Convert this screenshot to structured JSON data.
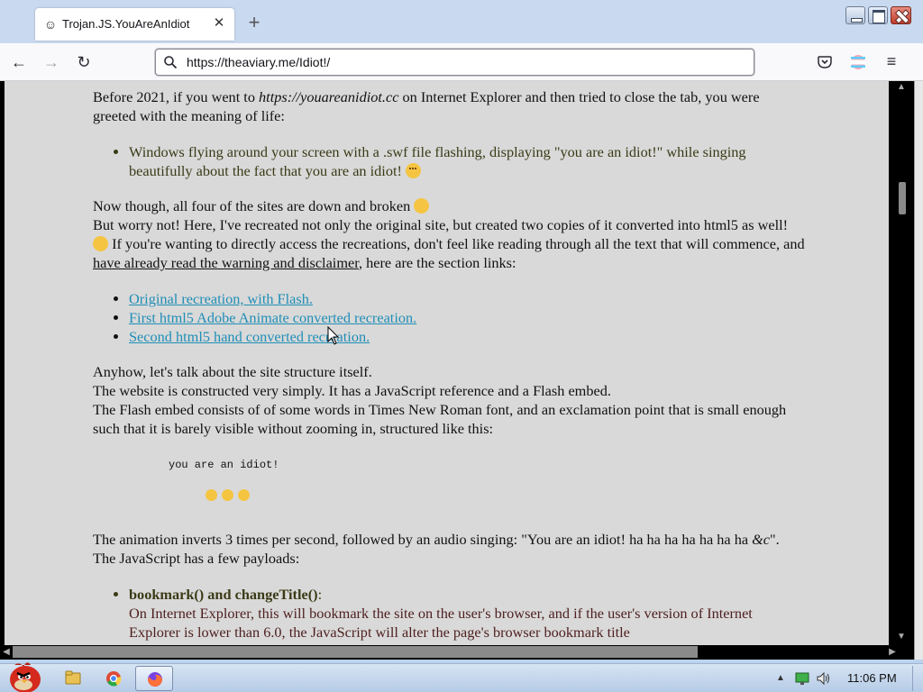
{
  "browser": {
    "tab": {
      "title": "Trojan.JS.YouAreAnIdiot",
      "favicon": "smiley-icon"
    },
    "url": "https://theaviary.me/Idiot!/",
    "toolbar_icons": [
      "back-icon",
      "forward-icon",
      "reload-icon",
      "search-icon",
      "pocket-icon",
      "account-icon",
      "menu-icon"
    ]
  },
  "article": {
    "p1_before": "Before 2021, if you went to ",
    "p1_site": "https://youareanidiot.cc",
    "p1_after": " on Internet Explorer and then tried to close the tab, you were greeted with the meaning of life:",
    "bullet1": "Windows flying around your screen with a .swf file flashing, displaying \"you are an idiot!\" while singing beautifully about the fact that you are an idiot!",
    "p2_line1": "Now though, all four of the sites are down and broken",
    "p2_line2": "But worry not! Here, I've recreated not only the original site, but created two copies of it converted into html5 as well!",
    "p2_line3_before": " If you're wanting to directly access the recreations, don't feel like reading through all the text that will commence, and ",
    "p2_line3_link": "have already read the warning and disclaimer",
    "p2_line3_after": ", here are the section links:",
    "links": [
      "Original recreation, with Flash.",
      "First html5 Adobe Animate converted recreation.",
      "Second html5 hand converted recreation."
    ],
    "p3_line1": "Anyhow, let's talk about the site structure itself.",
    "p3_line2": "The website is constructed very simply. It has a JavaScript reference and a Flash embed.",
    "p3_line3": "The Flash embed consists of of some words in Times New Roman font, and an exclamation point that is small enough such that it is barely visible without zooming in, structured like this:",
    "code_text": "you are an idiot!",
    "p4_line1": "The animation inverts 3 times per second, followed by an audio singing: \"You are an idiot! ha ha ha ha ha ha ha ",
    "p4_etc": "&c",
    "p4_line1_end": "\".",
    "p4_line2": "The JavaScript has a few payloads:",
    "payload_title": "bookmark() and changeTitle()",
    "payload_colon": ":",
    "payload_text": "On Internet Explorer, this will bookmark the site on the user's browser, and if the user's version of Internet Explorer is lower than 6.0, the JavaScript will alter the page's browser bookmark title"
  },
  "colors": {
    "page_background": "#d9d9d9",
    "link": "#1f8eb6",
    "olive_text": "#3a3a17",
    "dark_red_text": "#4e1e1e"
  },
  "taskbar": {
    "clock": "11:06 PM",
    "items": [
      "angry-birds-start-icon",
      "explorer-icon",
      "chrome-icon",
      "firefox-icon"
    ]
  }
}
